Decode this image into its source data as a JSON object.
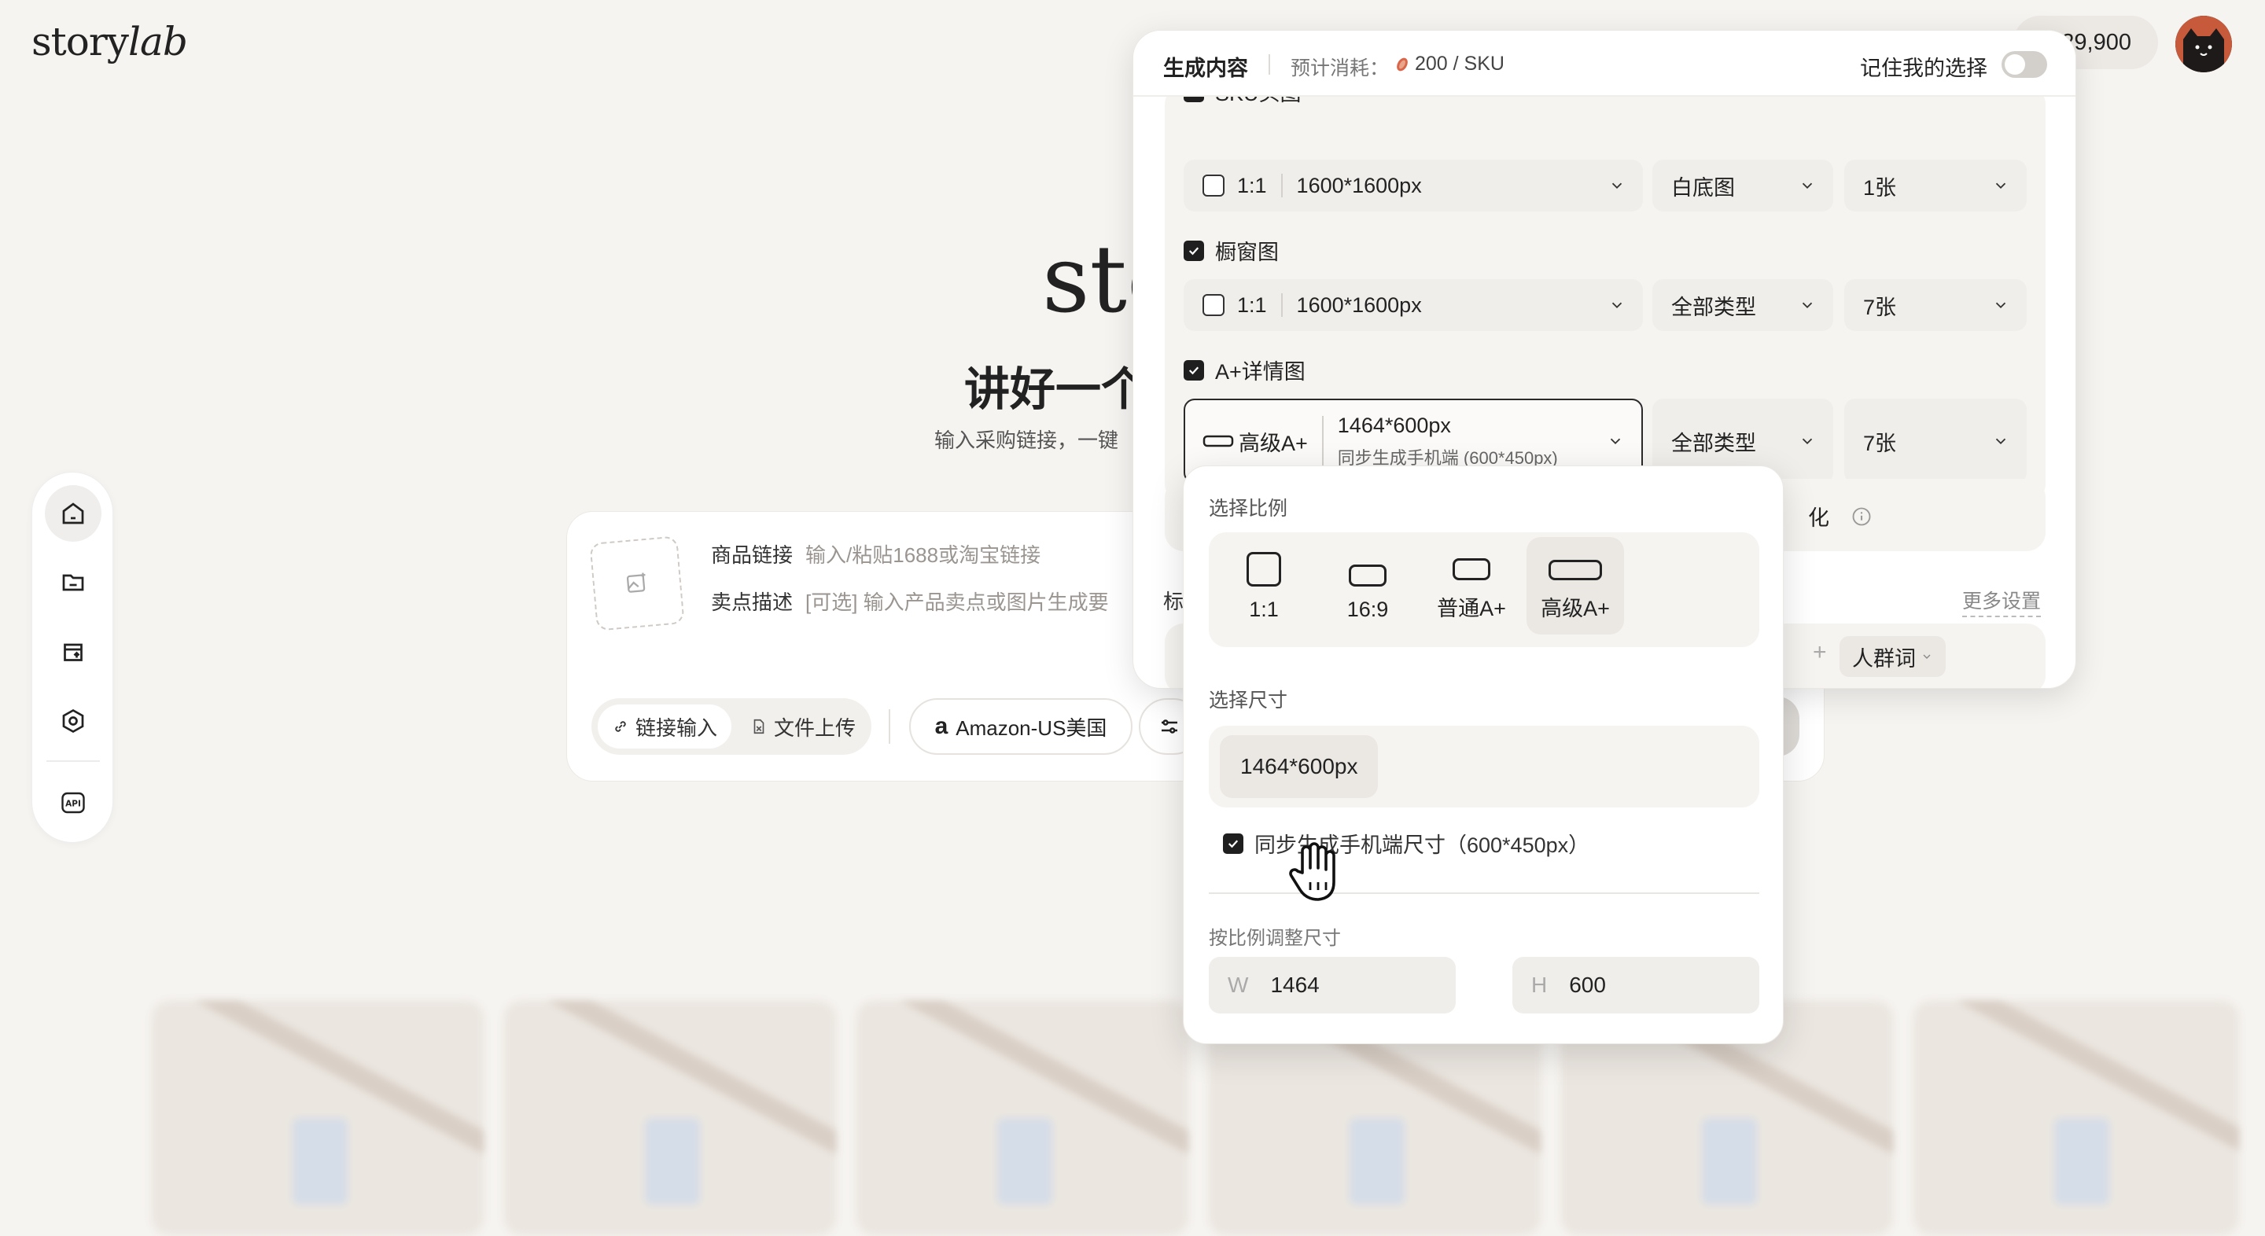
{
  "logo": {
    "prefix": "story",
    "suffix": "lab"
  },
  "header": {
    "credits": "29,900"
  },
  "hero": {
    "title": "sto",
    "subtitle": "讲好一个",
    "description": "输入采购链接，一键"
  },
  "input_card": {
    "product_link_label": "商品链接",
    "product_link_placeholder": "输入/粘贴1688或淘宝链接",
    "selling_point_label": "卖点描述",
    "selling_point_placeholder": "[可选] 输入产品卖点或图片生成要",
    "tab_link": "链接输入",
    "tab_upload": "文件上传",
    "marketplace": "Amazon-US美国"
  },
  "gallery": {
    "title": ""
  },
  "panel": {
    "title": "生成内容",
    "estimate_label": "预计消耗：",
    "estimate_value": "200 / SKU",
    "remember_label": "记住我的选择",
    "sections": [
      {
        "label": "SKU头图",
        "checked": true,
        "ratio": "1:1",
        "size": "1600*1600px",
        "type": "白底图",
        "count": "1张"
      },
      {
        "label": "橱窗图",
        "checked": true,
        "ratio": "1:1",
        "size": "1600*1600px",
        "type": "全部类型",
        "count": "7张"
      },
      {
        "label": "A+详情图",
        "checked": true,
        "ratio": "高级A+",
        "size": "1464*600px",
        "size_note": "同步生成手机端 (600*450px)",
        "type": "全部类型",
        "count": "7张"
      }
    ],
    "partial_left_label": "标",
    "partial_text": "化",
    "more_settings": "更多设置",
    "audience_tag": "人群词"
  },
  "popup": {
    "ratio_label": "选择比例",
    "ratios": [
      {
        "label": "1:1",
        "active": false
      },
      {
        "label": "16:9",
        "active": false
      },
      {
        "label": "普通A+",
        "active": false
      },
      {
        "label": "高级A+",
        "active": true
      }
    ],
    "size_label": "选择尺寸",
    "size_value": "1464*600px",
    "sync_label": "同步生成手机端尺寸（600*450px）",
    "scale_label": "按比例调整尺寸",
    "width_prefix": "W",
    "width_value": "1464",
    "height_prefix": "H",
    "height_value": "600"
  }
}
